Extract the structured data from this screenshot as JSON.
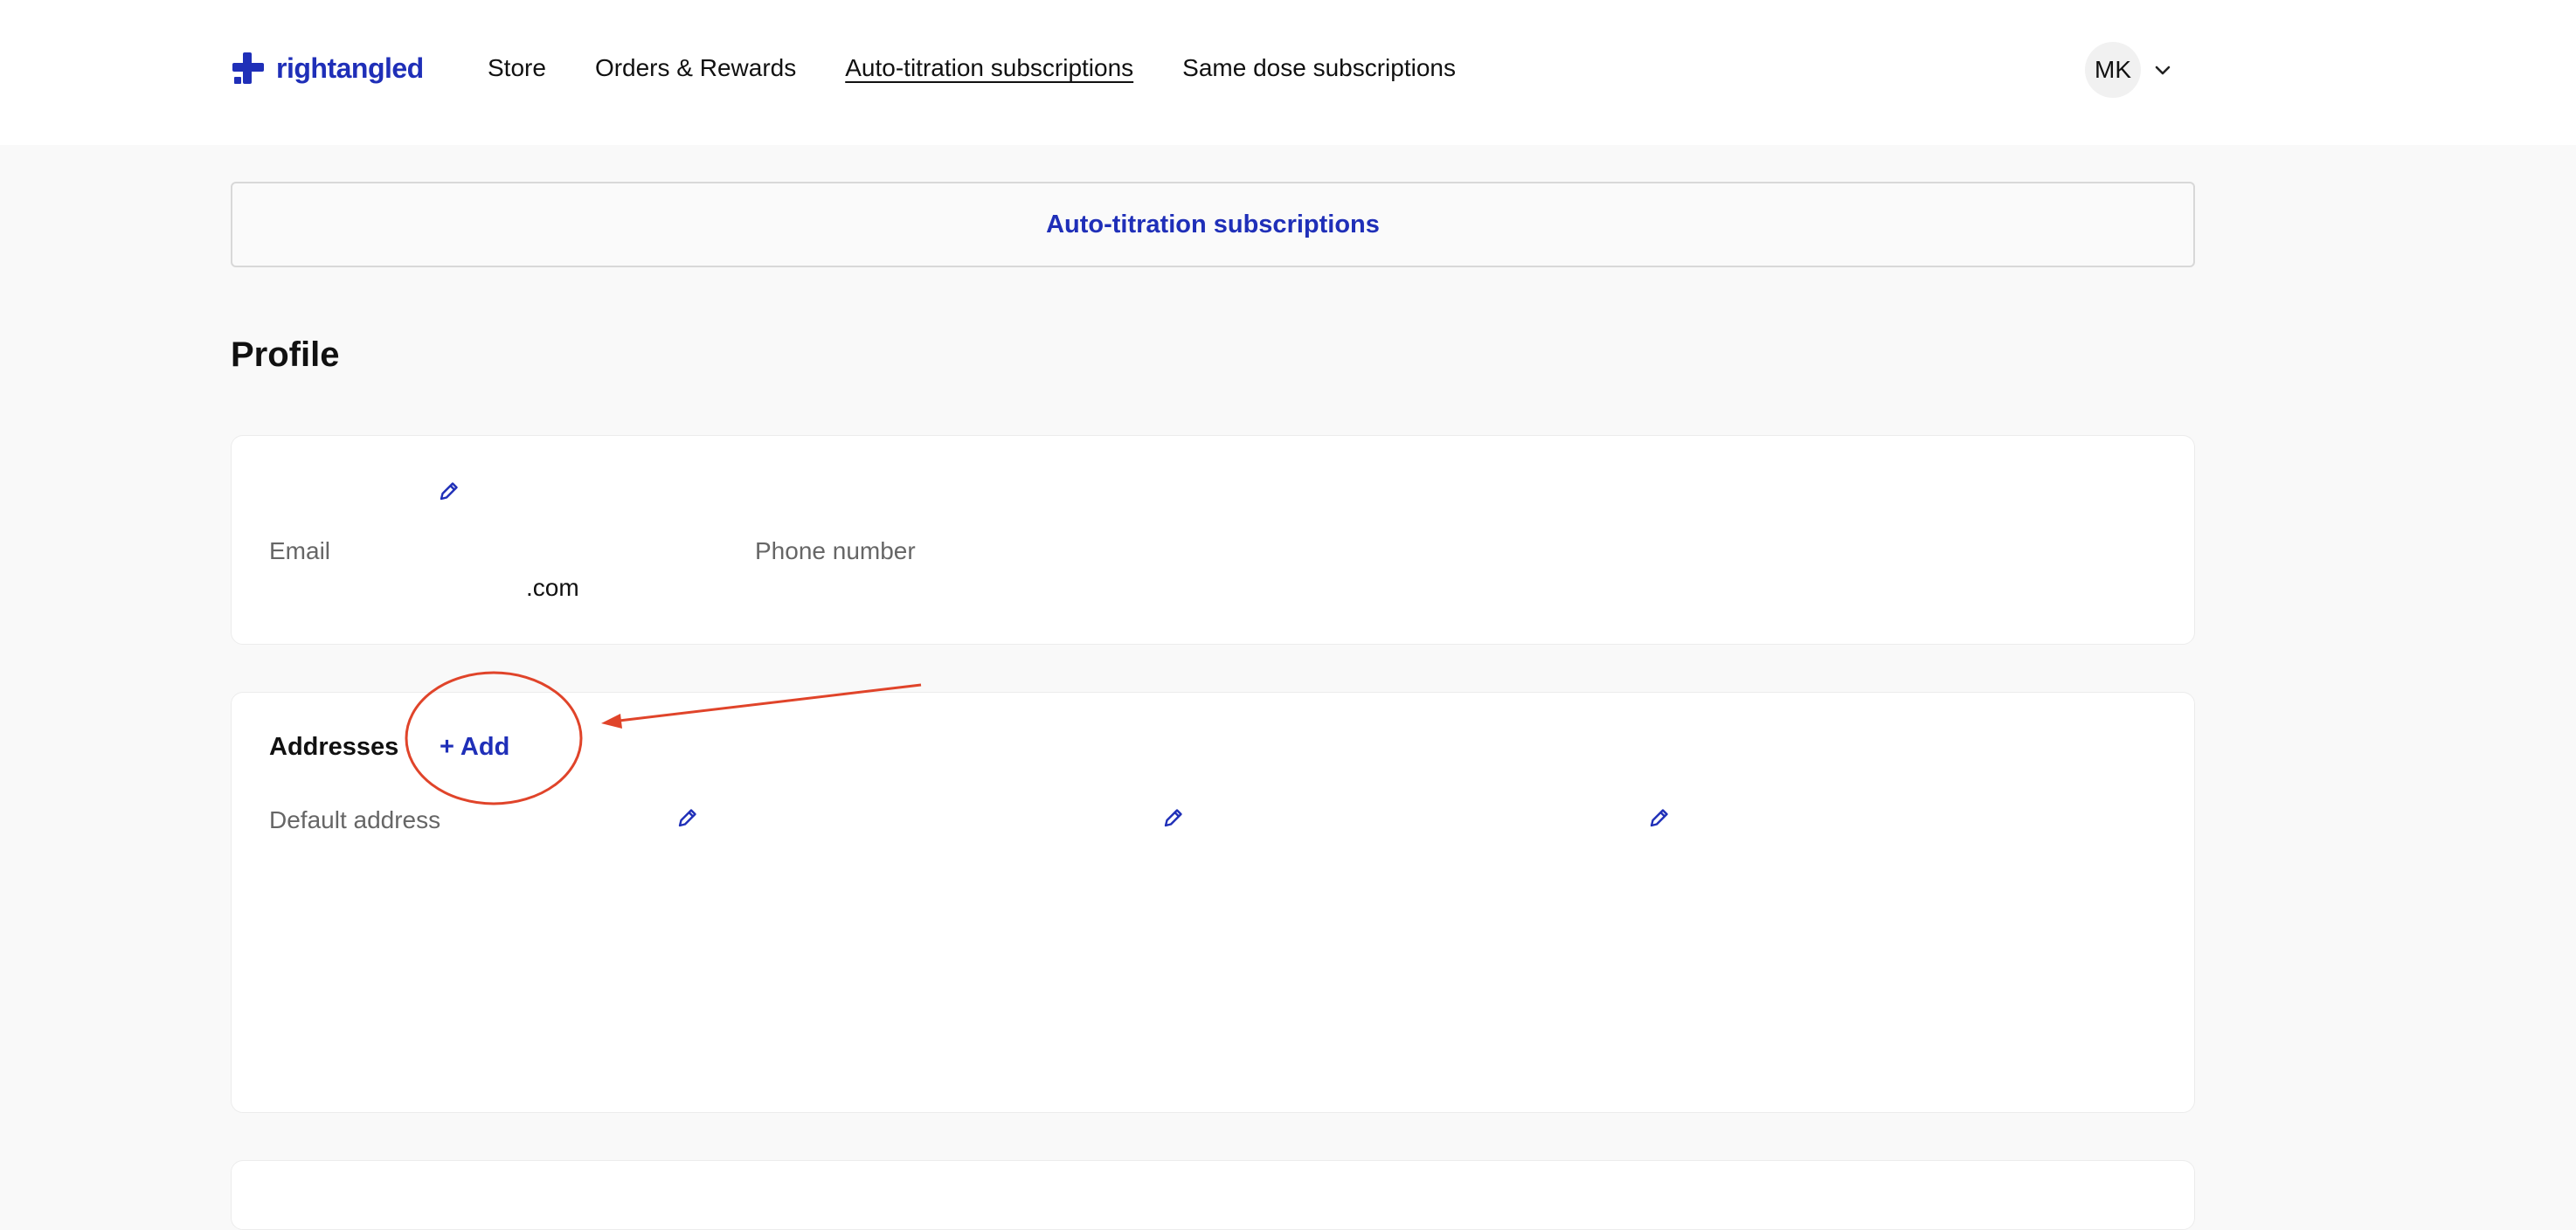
{
  "brand": {
    "name": "rightangled",
    "color": "#1f2fb8"
  },
  "nav": {
    "items": [
      {
        "label": "Store"
      },
      {
        "label": "Orders & Rewards"
      },
      {
        "label": "Auto-titration subscriptions",
        "active": true
      },
      {
        "label": "Same dose subscriptions"
      }
    ]
  },
  "user": {
    "initials": "MK"
  },
  "banner": {
    "label": "Auto-titration subscriptions"
  },
  "profile": {
    "title": "Profile",
    "email_label": "Email",
    "email_value": ".com",
    "phone_label": "Phone number"
  },
  "addresses": {
    "title": "Addresses",
    "add_label": "+ Add",
    "default_label": "Default address"
  },
  "icons": {
    "logo": "logo-mark-icon",
    "user_menu": "chevron-down-icon",
    "edit": "pencil-icon"
  },
  "annotation": {
    "color": "#e0442a"
  }
}
